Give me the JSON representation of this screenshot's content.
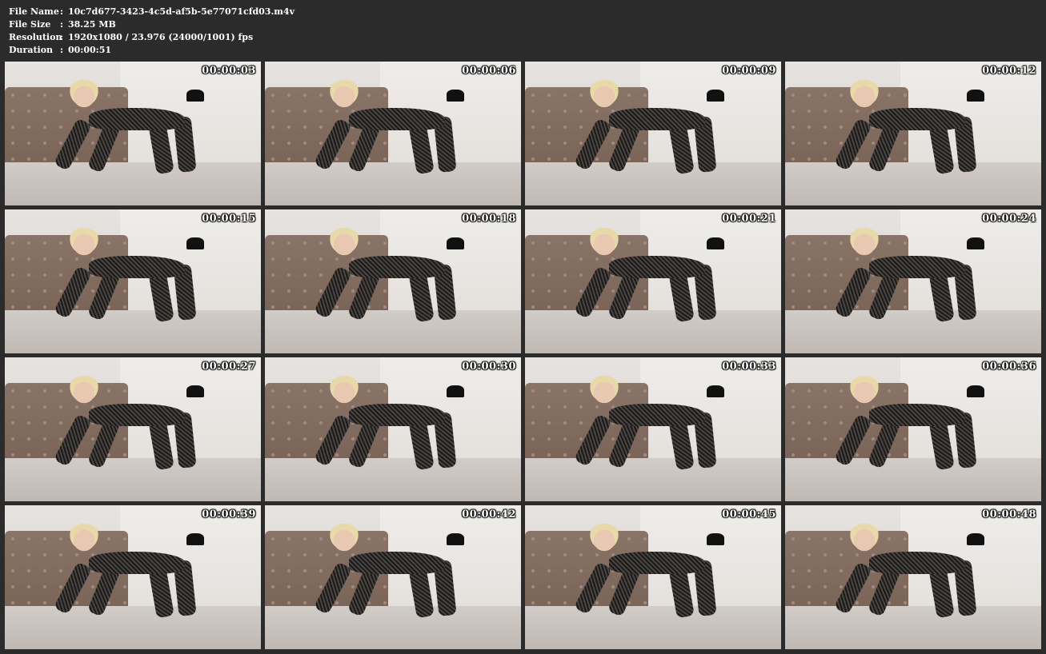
{
  "info": {
    "rows": [
      {
        "label": "File Name",
        "value": "10c7d677-3423-4c5d-af5b-5e77071cfd03.m4v"
      },
      {
        "label": "File Size",
        "value": "38.25 MB"
      },
      {
        "label": "Resolution",
        "value": "1920x1080 / 23.976 (24000/1001) fps"
      },
      {
        "label": "Duration",
        "value": "00:00:51"
      }
    ],
    "separator": ":"
  },
  "thumbnails": [
    "00:00:03",
    "00:00:06",
    "00:00:09",
    "00:00:12",
    "00:00:15",
    "00:00:18",
    "00:00:21",
    "00:00:24",
    "00:00:27",
    "00:00:30",
    "00:00:33",
    "00:00:36",
    "00:00:39",
    "00:00:42",
    "00:00:45",
    "00:00:48"
  ],
  "colors": {
    "background": "#2b2b2b",
    "text": "#ffffff"
  }
}
